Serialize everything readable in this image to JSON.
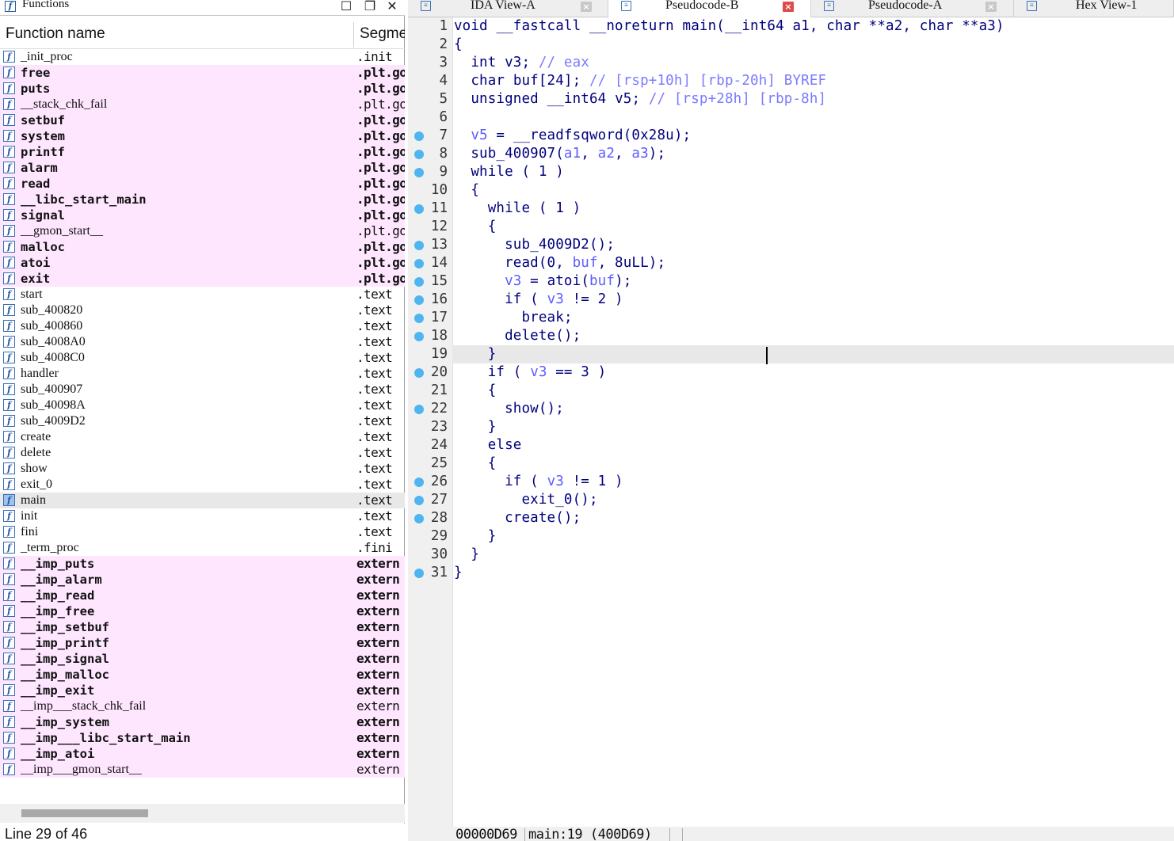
{
  "functions_panel": {
    "title": "Functions",
    "icon": "f-function-icon",
    "column_name": "Function name",
    "column_segment": "Segme",
    "status": "Line 29 of 46",
    "scrollbar_position": 0.05,
    "rows": [
      {
        "name": "_init_proc",
        "segment": ".init",
        "style": "normal"
      },
      {
        "name": "free",
        "segment": ".plt.got",
        "style": "bold"
      },
      {
        "name": "puts",
        "segment": ".plt.got",
        "style": "bold"
      },
      {
        "name": "__stack_chk_fail",
        "segment": ".plt.got",
        "style": "pink"
      },
      {
        "name": "setbuf",
        "segment": ".plt.got",
        "style": "bold"
      },
      {
        "name": "system",
        "segment": ".plt.got",
        "style": "bold"
      },
      {
        "name": "printf",
        "segment": ".plt.got",
        "style": "bold"
      },
      {
        "name": "alarm",
        "segment": ".plt.got",
        "style": "bold"
      },
      {
        "name": "read",
        "segment": ".plt.got",
        "style": "bold"
      },
      {
        "name": "__libc_start_main",
        "segment": ".plt.got",
        "style": "bold"
      },
      {
        "name": "signal",
        "segment": ".plt.got",
        "style": "bold"
      },
      {
        "name": "__gmon_start__",
        "segment": ".plt.got",
        "style": "pink"
      },
      {
        "name": "malloc",
        "segment": ".plt.got",
        "style": "bold"
      },
      {
        "name": "atoi",
        "segment": ".plt.got",
        "style": "bold"
      },
      {
        "name": "exit",
        "segment": ".plt.got",
        "style": "bold"
      },
      {
        "name": "start",
        "segment": ".text",
        "style": "normal"
      },
      {
        "name": "sub_400820",
        "segment": ".text",
        "style": "normal"
      },
      {
        "name": "sub_400860",
        "segment": ".text",
        "style": "normal"
      },
      {
        "name": "sub_4008A0",
        "segment": ".text",
        "style": "normal"
      },
      {
        "name": "sub_4008C0",
        "segment": ".text",
        "style": "normal"
      },
      {
        "name": "handler",
        "segment": ".text",
        "style": "normal"
      },
      {
        "name": "sub_400907",
        "segment": ".text",
        "style": "normal"
      },
      {
        "name": "sub_40098A",
        "segment": ".text",
        "style": "normal"
      },
      {
        "name": "sub_4009D2",
        "segment": ".text",
        "style": "normal"
      },
      {
        "name": "create",
        "segment": ".text",
        "style": "normal"
      },
      {
        "name": "delete",
        "segment": ".text",
        "style": "normal"
      },
      {
        "name": "show",
        "segment": ".text",
        "style": "normal"
      },
      {
        "name": "exit_0",
        "segment": ".text",
        "style": "normal"
      },
      {
        "name": "main",
        "segment": ".text",
        "style": "selected"
      },
      {
        "name": "init",
        "segment": ".text",
        "style": "normal"
      },
      {
        "name": "fini",
        "segment": ".text",
        "style": "normal"
      },
      {
        "name": "_term_proc",
        "segment": ".fini",
        "style": "normal"
      },
      {
        "name": "__imp_puts",
        "segment": "extern",
        "style": "bold"
      },
      {
        "name": "__imp_alarm",
        "segment": "extern",
        "style": "bold"
      },
      {
        "name": "__imp_read",
        "segment": "extern",
        "style": "bold"
      },
      {
        "name": "__imp_free",
        "segment": "extern",
        "style": "bold"
      },
      {
        "name": "__imp_setbuf",
        "segment": "extern",
        "style": "bold"
      },
      {
        "name": "__imp_printf",
        "segment": "extern",
        "style": "bold"
      },
      {
        "name": "__imp_signal",
        "segment": "extern",
        "style": "bold"
      },
      {
        "name": "__imp_malloc",
        "segment": "extern",
        "style": "bold"
      },
      {
        "name": "__imp_exit",
        "segment": "extern",
        "style": "bold"
      },
      {
        "name": "__imp___stack_chk_fail",
        "segment": "extern",
        "style": "pink"
      },
      {
        "name": "__imp_system",
        "segment": "extern",
        "style": "bold"
      },
      {
        "name": "__imp___libc_start_main",
        "segment": "extern",
        "style": "bold"
      },
      {
        "name": "__imp_atoi",
        "segment": "extern",
        "style": "bold"
      },
      {
        "name": "__imp___gmon_start__",
        "segment": "extern",
        "style": "pink"
      }
    ]
  },
  "tabs": [
    {
      "label": "IDA View-A",
      "icon": "disassembly-icon",
      "active": false
    },
    {
      "label": "Pseudocode-B",
      "icon": "pseudocode-icon",
      "active": true
    },
    {
      "label": "Pseudocode-A",
      "icon": "pseudocode-icon",
      "active": false
    },
    {
      "label": "Hex View-1",
      "icon": "hex-icon",
      "active": false
    }
  ],
  "code_lines": [
    {
      "num": "1",
      "bp": false,
      "tokens": [
        [
          "kw",
          "void "
        ],
        [
          "kw",
          "__fastcall "
        ],
        [
          "kw",
          "__noreturn "
        ],
        [
          "fn",
          "main"
        ],
        [
          "p",
          "("
        ],
        [
          "kw",
          "__int64 "
        ],
        [
          "v",
          "a1"
        ],
        [
          "p",
          ", "
        ],
        [
          "kw",
          "char "
        ],
        [
          "p",
          "**"
        ],
        [
          "v",
          "a2"
        ],
        [
          "p",
          ", "
        ],
        [
          "kw",
          "char "
        ],
        [
          "p",
          "**"
        ],
        [
          "v",
          "a3"
        ],
        [
          "p",
          ")"
        ]
      ]
    },
    {
      "num": "2",
      "bp": false,
      "tokens": [
        [
          "p",
          "{"
        ]
      ]
    },
    {
      "num": "3",
      "bp": false,
      "tokens": [
        [
          "p",
          "  "
        ],
        [
          "kw",
          "int "
        ],
        [
          "v",
          "v3"
        ],
        [
          "p",
          "; "
        ],
        [
          "c",
          "// eax"
        ]
      ]
    },
    {
      "num": "4",
      "bp": false,
      "tokens": [
        [
          "p",
          "  "
        ],
        [
          "kw",
          "char "
        ],
        [
          "v",
          "buf"
        ],
        [
          "p",
          "[24]; "
        ],
        [
          "c",
          "// [rsp+10h] [rbp-20h] BYREF"
        ]
      ]
    },
    {
      "num": "5",
      "bp": false,
      "tokens": [
        [
          "p",
          "  "
        ],
        [
          "kw",
          "unsigned "
        ],
        [
          "kw",
          "__int64 "
        ],
        [
          "v",
          "v5"
        ],
        [
          "p",
          "; "
        ],
        [
          "c",
          "// [rsp+28h] [rbp-8h]"
        ]
      ]
    },
    {
      "num": "6",
      "bp": false,
      "tokens": []
    },
    {
      "num": "7",
      "bp": true,
      "tokens": [
        [
          "p",
          "  "
        ],
        [
          "lv",
          "v5"
        ],
        [
          "p",
          " = "
        ],
        [
          "fn",
          "__readfsqword"
        ],
        [
          "p",
          "(0x28u);"
        ]
      ]
    },
    {
      "num": "8",
      "bp": true,
      "tokens": [
        [
          "p",
          "  "
        ],
        [
          "fn",
          "sub_400907"
        ],
        [
          "p",
          "("
        ],
        [
          "lv",
          "a1"
        ],
        [
          "p",
          ", "
        ],
        [
          "lv",
          "a2"
        ],
        [
          "p",
          ", "
        ],
        [
          "lv",
          "a3"
        ],
        [
          "p",
          ");"
        ]
      ]
    },
    {
      "num": "9",
      "bp": true,
      "tokens": [
        [
          "p",
          "  "
        ],
        [
          "kw",
          "while"
        ],
        [
          "p",
          " ( 1 )"
        ]
      ]
    },
    {
      "num": "10",
      "bp": false,
      "tokens": [
        [
          "p",
          "  {"
        ]
      ]
    },
    {
      "num": "11",
      "bp": true,
      "tokens": [
        [
          "p",
          "    "
        ],
        [
          "kw",
          "while"
        ],
        [
          "p",
          " ( 1 )"
        ]
      ]
    },
    {
      "num": "12",
      "bp": false,
      "tokens": [
        [
          "p",
          "    {"
        ]
      ]
    },
    {
      "num": "13",
      "bp": true,
      "tokens": [
        [
          "p",
          "      "
        ],
        [
          "fn",
          "sub_4009D2"
        ],
        [
          "p",
          "();"
        ]
      ]
    },
    {
      "num": "14",
      "bp": true,
      "tokens": [
        [
          "p",
          "      "
        ],
        [
          "fn",
          "read"
        ],
        [
          "p",
          "(0, "
        ],
        [
          "lv",
          "buf"
        ],
        [
          "p",
          ", 8uLL);"
        ]
      ]
    },
    {
      "num": "15",
      "bp": true,
      "tokens": [
        [
          "p",
          "      "
        ],
        [
          "lv",
          "v3"
        ],
        [
          "p",
          " = "
        ],
        [
          "fn",
          "atoi"
        ],
        [
          "p",
          "("
        ],
        [
          "lv",
          "buf"
        ],
        [
          "p",
          ");"
        ]
      ]
    },
    {
      "num": "16",
      "bp": true,
      "tokens": [
        [
          "p",
          "      "
        ],
        [
          "kw",
          "if"
        ],
        [
          "p",
          " ( "
        ],
        [
          "lv",
          "v3"
        ],
        [
          "p",
          " != 2 )"
        ]
      ]
    },
    {
      "num": "17",
      "bp": true,
      "tokens": [
        [
          "p",
          "        "
        ],
        [
          "kw",
          "break"
        ],
        [
          "p",
          ";"
        ]
      ]
    },
    {
      "num": "18",
      "bp": true,
      "tokens": [
        [
          "p",
          "      "
        ],
        [
          "fn",
          "delete"
        ],
        [
          "p",
          "();"
        ]
      ]
    },
    {
      "num": "19",
      "bp": false,
      "cur": true,
      "tokens": [
        [
          "p",
          "    }"
        ]
      ]
    },
    {
      "num": "20",
      "bp": true,
      "tokens": [
        [
          "p",
          "    "
        ],
        [
          "kw",
          "if"
        ],
        [
          "p",
          " ( "
        ],
        [
          "lv",
          "v3"
        ],
        [
          "p",
          " == 3 )"
        ]
      ]
    },
    {
      "num": "21",
      "bp": false,
      "tokens": [
        [
          "p",
          "    {"
        ]
      ]
    },
    {
      "num": "22",
      "bp": true,
      "tokens": [
        [
          "p",
          "      "
        ],
        [
          "fn",
          "show"
        ],
        [
          "p",
          "();"
        ]
      ]
    },
    {
      "num": "23",
      "bp": false,
      "tokens": [
        [
          "p",
          "    }"
        ]
      ]
    },
    {
      "num": "24",
      "bp": false,
      "tokens": [
        [
          "p",
          "    "
        ],
        [
          "kw",
          "else"
        ]
      ]
    },
    {
      "num": "25",
      "bp": false,
      "tokens": [
        [
          "p",
          "    {"
        ]
      ]
    },
    {
      "num": "26",
      "bp": true,
      "tokens": [
        [
          "p",
          "      "
        ],
        [
          "kw",
          "if"
        ],
        [
          "p",
          " ( "
        ],
        [
          "lv",
          "v3"
        ],
        [
          "p",
          " != 1 )"
        ]
      ]
    },
    {
      "num": "27",
      "bp": true,
      "tokens": [
        [
          "p",
          "        "
        ],
        [
          "fn",
          "exit_0"
        ],
        [
          "p",
          "();"
        ]
      ]
    },
    {
      "num": "28",
      "bp": true,
      "tokens": [
        [
          "p",
          "      "
        ],
        [
          "fn",
          "create"
        ],
        [
          "p",
          "();"
        ]
      ]
    },
    {
      "num": "29",
      "bp": false,
      "tokens": [
        [
          "p",
          "    }"
        ]
      ]
    },
    {
      "num": "30",
      "bp": false,
      "tokens": [
        [
          "p",
          "  }"
        ]
      ]
    },
    {
      "num": "31",
      "bp": true,
      "tokens": [
        [
          "p",
          "}"
        ]
      ]
    }
  ],
  "code_status": {
    "offset": "00000D69",
    "location": "main:19 (400D69)"
  },
  "colors": {
    "keyword": "#00007f",
    "local_var": "#5c5cff",
    "comment": "#7a7aff",
    "plain": "#00007f",
    "import_bg": "#ffe6ff",
    "breakpoint": "#4fb5f0"
  }
}
